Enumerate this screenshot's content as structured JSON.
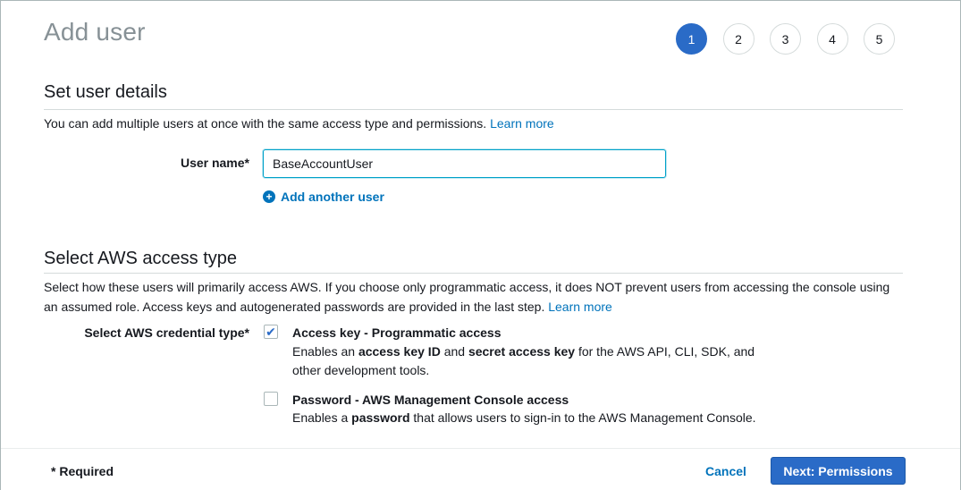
{
  "page": {
    "title": "Add user"
  },
  "steps": [
    "1",
    "2",
    "3",
    "4",
    "5"
  ],
  "user_details": {
    "title": "Set user details",
    "description": "You can add multiple users at once with the same access type and permissions.",
    "learn_more": "Learn more",
    "username_label": "User name*",
    "username_value": "BaseAccountUser",
    "add_another": "Add another user"
  },
  "access_type": {
    "title": "Select AWS access type",
    "description": "Select how these users will primarily access AWS. If you choose only programmatic access, it does NOT prevent users from accessing the console using an assumed role. Access keys and autogenerated passwords are provided in the last step.",
    "learn_more": "Learn more",
    "credential_label": "Select AWS credential type*",
    "options": [
      {
        "title": "Access key - Programmatic access",
        "checked": true,
        "desc_parts": [
          "Enables an ",
          "access key ID",
          " and ",
          "secret access key",
          " for the AWS API, CLI, SDK, and other development tools."
        ]
      },
      {
        "title": "Password - AWS Management Console access",
        "checked": false,
        "desc_parts": [
          "Enables a ",
          "password",
          " that allows users to sign-in to the AWS Management Console."
        ]
      }
    ]
  },
  "footer": {
    "required": "* Required",
    "cancel": "Cancel",
    "next": "Next: Permissions"
  },
  "colors": {
    "primary": "#2a6bc7",
    "link": "#0073bb",
    "title_gray": "#879196"
  }
}
